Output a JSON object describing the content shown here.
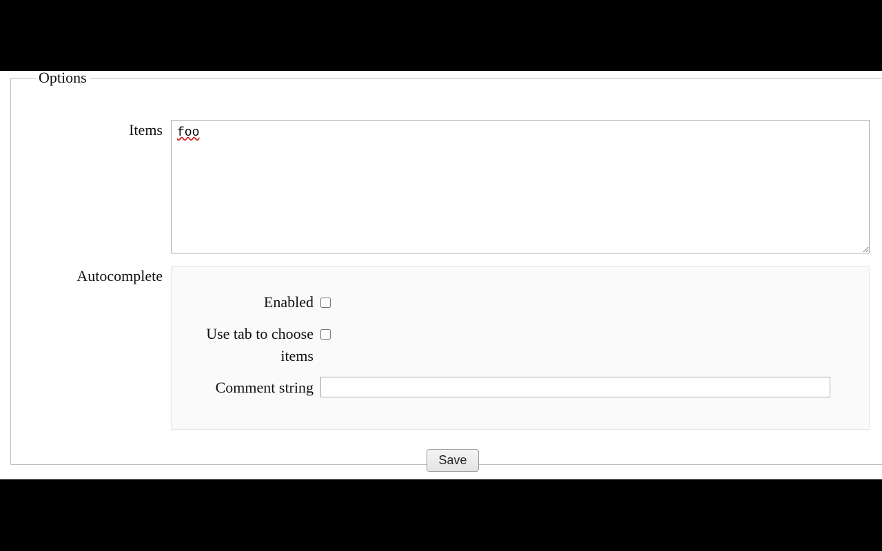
{
  "fieldset": {
    "legend": "Options"
  },
  "items": {
    "label": "Items",
    "value": "foo"
  },
  "autocomplete": {
    "label": "Autocomplete",
    "enabled": {
      "label": "Enabled",
      "checked": false
    },
    "use_tab": {
      "label": "Use tab to choose items",
      "checked": false
    },
    "comment_string": {
      "label": "Comment string",
      "value": ""
    }
  },
  "actions": {
    "save": "Save"
  }
}
